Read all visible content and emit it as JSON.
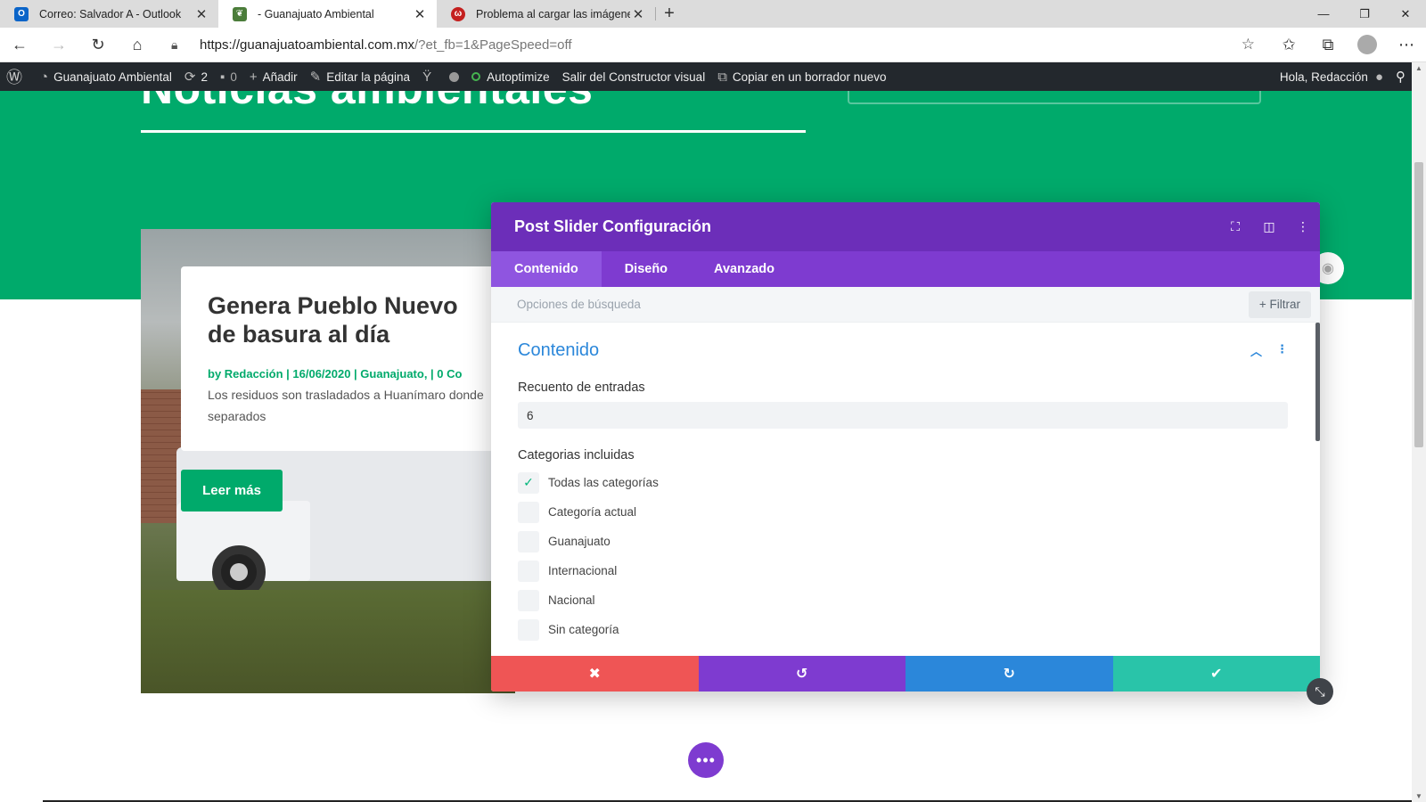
{
  "browser": {
    "tabs": [
      {
        "title": "Correo: Salvador A - Outlook",
        "icon": "outlook-icon",
        "color": "#0a64c8"
      },
      {
        "title": "- Guanajuato Ambiental",
        "icon": "leaf-icon",
        "color": "#4b7d3a"
      },
      {
        "title": "Problema al cargar las imágenes",
        "icon": "wpe-icon",
        "color": "#c4201f"
      }
    ],
    "url_main": "https://guanajuatoambiental.com.mx",
    "url_rest": "/?et_fb=1&PageSpeed=off"
  },
  "adminbar": {
    "site_name": "Guanajuato Ambiental",
    "updates_count": "2",
    "comments_count": "0",
    "add_label": "Añadir",
    "edit_label": "Editar la página",
    "autoptimize_label": "Autoptimize",
    "exit_builder_label": "Salir del Constructor visual",
    "copy_draft_label": "Copiar en un borrador nuevo",
    "greeting": "Hola, Redacción"
  },
  "page": {
    "hero_title": "Noticias ambientales",
    "post": {
      "title_line1": "Genera Pueblo Nuevo",
      "title_line2": "de basura al día",
      "meta": "by Redacción | 16/06/2020 | Guanajuato, | 0 Co",
      "excerpt_line1": "Los residuos son trasladados a Huanímaro donde",
      "excerpt_line2": "separados",
      "read_more": "Leer más"
    }
  },
  "modal": {
    "title": "Post Slider Configuración",
    "tabs": [
      "Contenido",
      "Diseño",
      "Avanzado"
    ],
    "search_placeholder": "Opciones de búsqueda",
    "filter_label": "+ Filtrar",
    "section_title": "Contenido",
    "post_count_label": "Recuento de entradas",
    "post_count_value": "6",
    "categories_label": "Categorias incluidas",
    "categories": [
      {
        "label": "Todas las categorías",
        "checked": true
      },
      {
        "label": "Categoría actual",
        "checked": false
      },
      {
        "label": "Guanajuato",
        "checked": false
      },
      {
        "label": "Internacional",
        "checked": false
      },
      {
        "label": "Nacional",
        "checked": false
      },
      {
        "label": "Sin categoría",
        "checked": false
      }
    ]
  },
  "colors": {
    "brand_green": "#00aa6b",
    "divi_purple": "#6c2eb9",
    "divi_tab_purple": "#7e3bd0",
    "cancel_red": "#ef5555",
    "redo_blue": "#2b87da",
    "save_teal": "#29c4a9"
  }
}
